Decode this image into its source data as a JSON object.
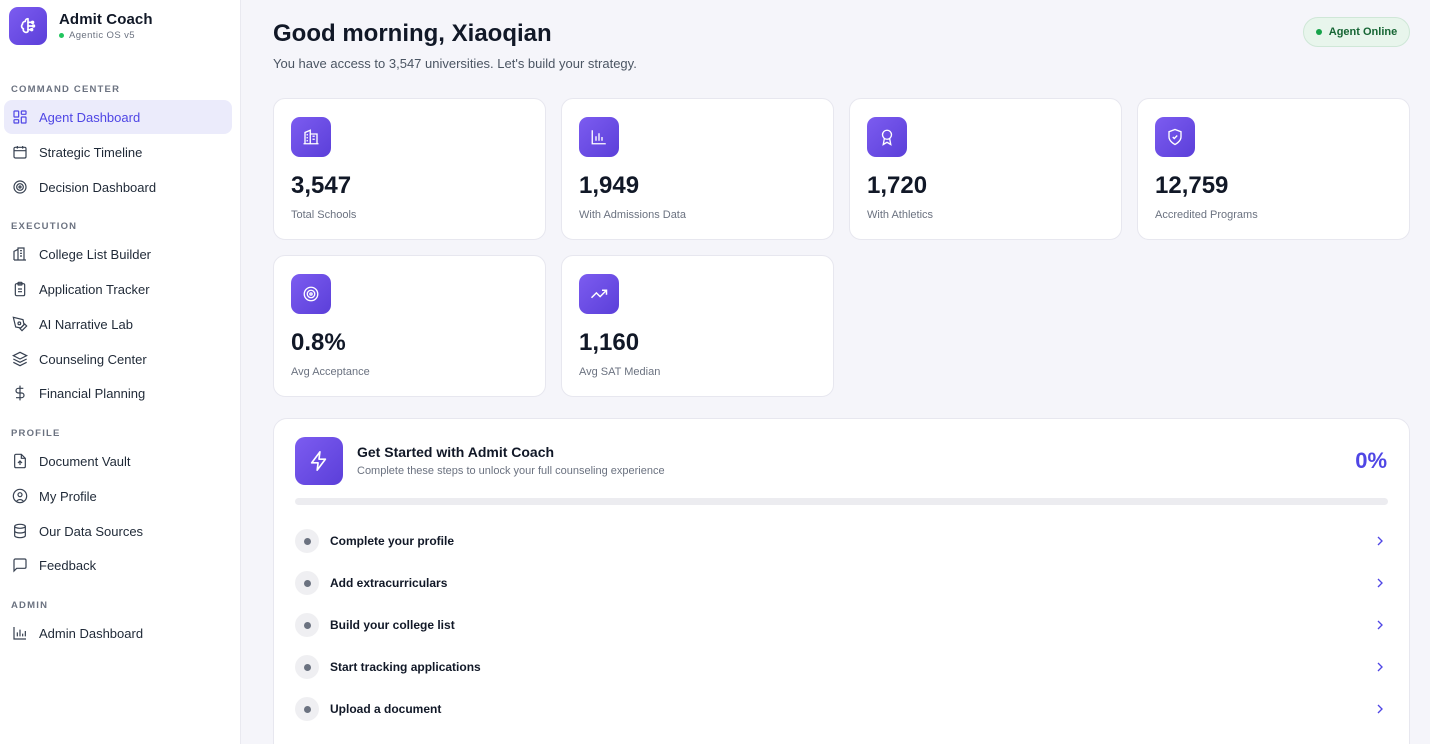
{
  "brand": {
    "title": "Admit Coach",
    "subtitle": "Agentic OS v5"
  },
  "sidebar": {
    "sections": [
      {
        "label": "COMMAND CENTER",
        "items": [
          {
            "label": "Agent Dashboard",
            "icon": "grid-icon",
            "active": true
          },
          {
            "label": "Strategic Timeline",
            "icon": "calendar-icon"
          },
          {
            "label": "Decision Dashboard",
            "icon": "target-icon"
          }
        ]
      },
      {
        "label": "EXECUTION",
        "items": [
          {
            "label": "College List Builder",
            "icon": "building-icon"
          },
          {
            "label": "Application Tracker",
            "icon": "clipboard-icon"
          },
          {
            "label": "AI Narrative Lab",
            "icon": "pen-tool-icon"
          },
          {
            "label": "Counseling Center",
            "icon": "layers-icon"
          },
          {
            "label": "Financial Planning",
            "icon": "dollar-icon"
          }
        ]
      },
      {
        "label": "PROFILE",
        "items": [
          {
            "label": "Document Vault",
            "icon": "file-upload-icon"
          },
          {
            "label": "My Profile",
            "icon": "user-circle-icon"
          },
          {
            "label": "Our Data Sources",
            "icon": "database-icon"
          },
          {
            "label": "Feedback",
            "icon": "message-square-icon"
          }
        ]
      },
      {
        "label": "ADMIN",
        "items": [
          {
            "label": "Admin Dashboard",
            "icon": "bar-chart-icon"
          }
        ]
      }
    ]
  },
  "header": {
    "greeting": "Good morning, Xiaoqian",
    "subtitle": "You have access to 3,547 universities. Let's build your strategy.",
    "agent_status": "Agent Online"
  },
  "stats": [
    {
      "value": "3,547",
      "label": "Total Schools",
      "icon": "building-icon"
    },
    {
      "value": "1,949",
      "label": "With Admissions Data",
      "icon": "bar-chart-icon"
    },
    {
      "value": "1,720",
      "label": "With Athletics",
      "icon": "award-icon"
    },
    {
      "value": "12,759",
      "label": "Accredited Programs",
      "icon": "shield-check-icon"
    },
    {
      "value": "0.8%",
      "label": "Avg Acceptance",
      "icon": "target-icon"
    },
    {
      "value": "1,160",
      "label": "Avg SAT Median",
      "icon": "trending-up-icon"
    }
  ],
  "getting_started": {
    "title": "Get Started with Admit Coach",
    "subtitle": "Complete these steps to unlock your full counseling experience",
    "percent": "0%",
    "progress_fraction": 0,
    "icon": "lightning-icon",
    "steps": [
      {
        "label": "Complete your profile"
      },
      {
        "label": "Add extracurriculars"
      },
      {
        "label": "Build your college list"
      },
      {
        "label": "Start tracking applications"
      },
      {
        "label": "Upload a document"
      }
    ]
  },
  "colors": {
    "accent": "#4f46e5",
    "brand_gradient_start": "#7c5cf0",
    "brand_gradient_end": "#5b3fd9",
    "online": "#16a34a"
  }
}
